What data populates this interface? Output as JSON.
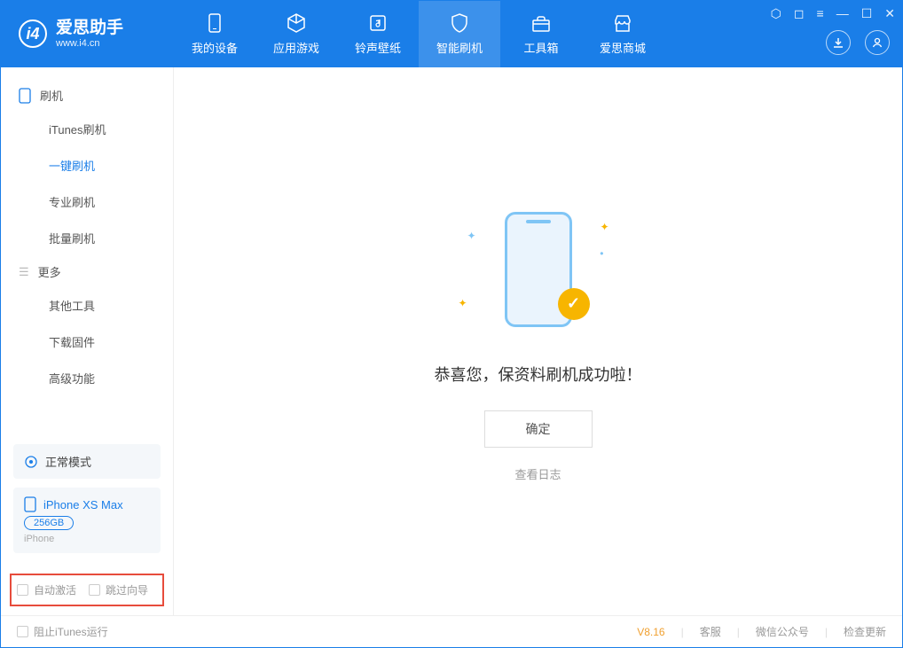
{
  "app": {
    "name": "爱思助手",
    "subtitle": "www.i4.cn"
  },
  "nav": {
    "tabs": [
      {
        "label": "我的设备"
      },
      {
        "label": "应用游戏"
      },
      {
        "label": "铃声壁纸"
      },
      {
        "label": "智能刷机"
      },
      {
        "label": "工具箱"
      },
      {
        "label": "爱思商城"
      }
    ]
  },
  "sidebar": {
    "group1_label": "刷机",
    "items1": [
      {
        "label": "iTunes刷机"
      },
      {
        "label": "一键刷机"
      },
      {
        "label": "专业刷机"
      },
      {
        "label": "批量刷机"
      }
    ],
    "group2_label": "更多",
    "items2": [
      {
        "label": "其他工具"
      },
      {
        "label": "下载固件"
      },
      {
        "label": "高级功能"
      }
    ],
    "mode": "正常模式",
    "device_name": "iPhone XS Max",
    "capacity": "256GB",
    "device_type": "iPhone",
    "opt1": "自动激活",
    "opt2": "跳过向导"
  },
  "main": {
    "title": "恭喜您，保资料刷机成功啦！",
    "confirm": "确定",
    "log_link": "查看日志"
  },
  "footer": {
    "stop_itunes": "阻止iTunes运行",
    "version": "V8.16",
    "support": "客服",
    "wechat": "微信公众号",
    "update": "检查更新"
  }
}
